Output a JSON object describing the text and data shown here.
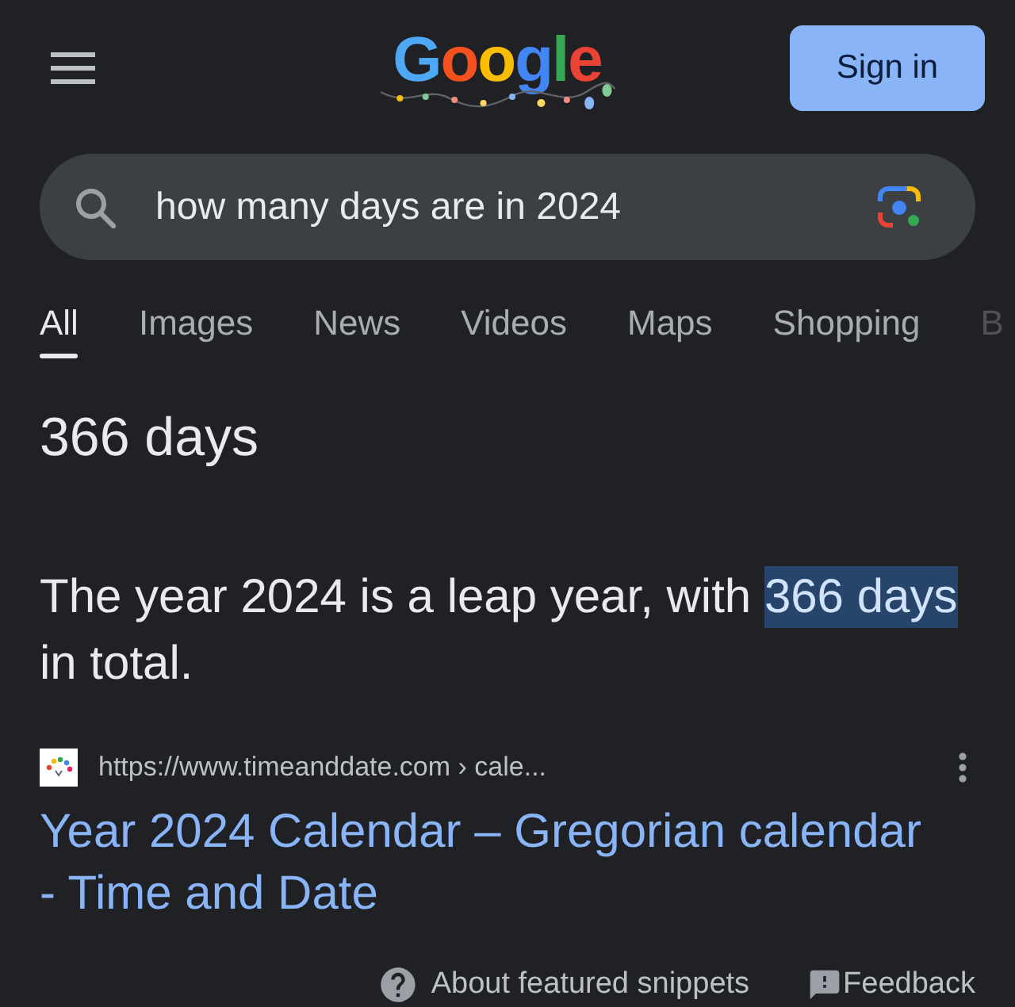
{
  "header": {
    "logo": "Google",
    "sign_in_button": "Sign in"
  },
  "search": {
    "value": "how many days are in 2024"
  },
  "tabs": [
    {
      "label": "All",
      "selected": true
    },
    {
      "label": "Images",
      "selected": false
    },
    {
      "label": "News",
      "selected": false
    },
    {
      "label": "Videos",
      "selected": false
    },
    {
      "label": "Maps",
      "selected": false
    },
    {
      "label": "Shopping",
      "selected": false
    },
    {
      "label": "B",
      "selected": false
    }
  ],
  "answer": {
    "title": "366 days",
    "parts": [
      {
        "text": "The year 2024 is a leap year, with ",
        "highlighted": false
      },
      {
        "text": "366 days",
        "highlighted": true
      },
      {
        "text": " in total.",
        "highlighted": false
      }
    ]
  },
  "result": {
    "url": "https://www.timeanddate.com › cale...",
    "title": "Year 2024 Calendar – Gregorian calendar - Time and Date"
  },
  "footer": {
    "links": [
      {
        "kind": "help",
        "label": "About featured snippets"
      },
      {
        "kind": "feedback",
        "label": "Feedback"
      }
    ]
  }
}
